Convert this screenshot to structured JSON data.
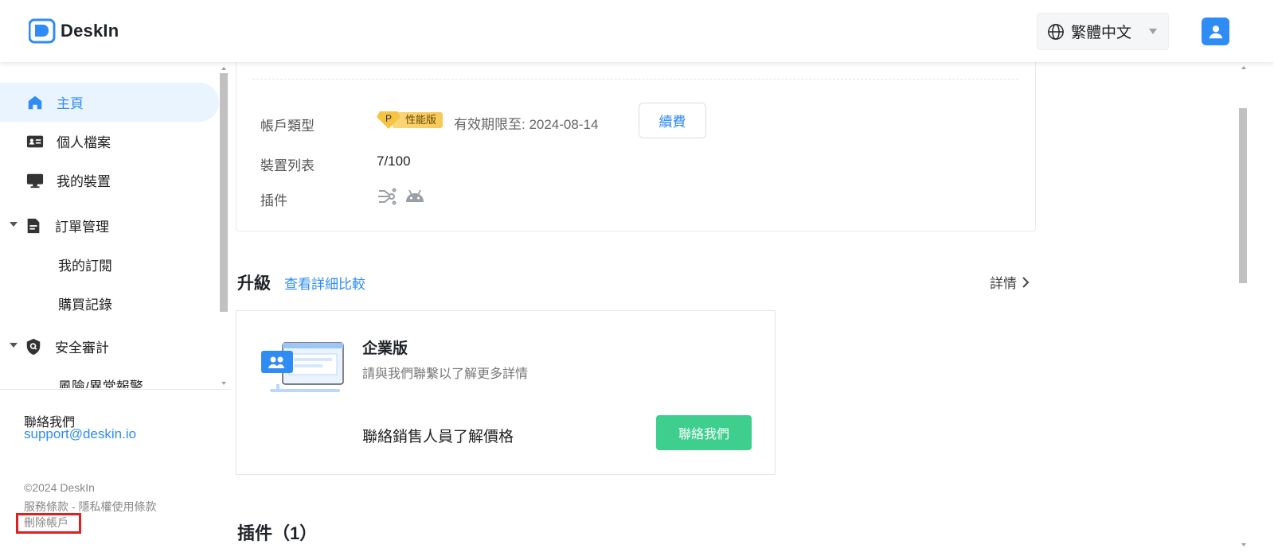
{
  "header": {
    "app_name": "DeskIn",
    "language_selected": "繁體中文"
  },
  "sidebar": {
    "items": [
      {
        "label": "主頁",
        "icon": "home-icon",
        "active": true
      },
      {
        "label": "個人檔案",
        "icon": "id-card-icon"
      },
      {
        "label": "我的裝置",
        "icon": "monitor-icon"
      },
      {
        "label": "訂單管理",
        "icon": "document-icon",
        "expanded": true
      },
      {
        "label": "我的訂閱"
      },
      {
        "label": "購買記錄"
      },
      {
        "label": "安全審計",
        "icon": "shield-icon",
        "expanded": true
      },
      {
        "label": "風險/異常報警"
      }
    ],
    "contact_label": "聯絡我們",
    "contact_email": "support@deskin.io",
    "copyright": "©2024 DeskIn",
    "terms": "服務條款 - 隱私權使用條款",
    "delete_account": "刪除帳戶"
  },
  "account": {
    "type_label": "帳戶類型",
    "badge_letter": "P",
    "badge_text": "性能版",
    "valid_until": "有效期限至:  2024-08-14",
    "renew_button": "續費",
    "devices_label": "裝置列表",
    "devices_value": "7/100",
    "plugins_label": "插件"
  },
  "upgrade": {
    "title": "升級",
    "compare_link": "查看詳細比較",
    "details_link": "詳情"
  },
  "enterprise": {
    "title": "企業版",
    "description": "請與我們聯繫以了解更多詳情",
    "price_text": "聯絡銷售人員了解價格",
    "contact_button": "聯絡我們"
  },
  "plugins_section": {
    "title": "插件（1）"
  },
  "colors": {
    "accent": "#2f8cf4",
    "contact_button": "#3ecf8e",
    "active_nav_bg": "#eaf4fe",
    "highlight_box": "#e02020"
  }
}
